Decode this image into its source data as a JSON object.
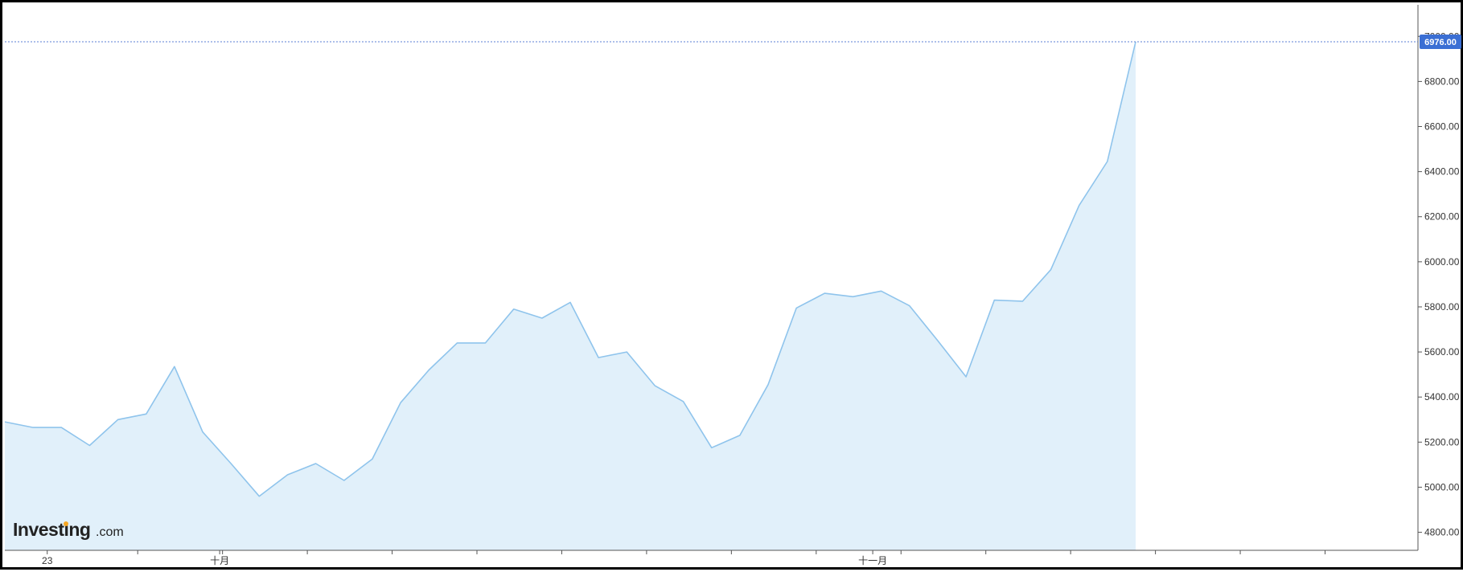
{
  "logo": {
    "main": "Investing",
    "suffix": ".com",
    "accent_color": "#f5a623"
  },
  "colors": {
    "line": "#8fc4ec",
    "area": "#e1f0fa",
    "badge": "#3b6fd4",
    "price_line": "#5b7fd6",
    "axis": "#555555",
    "frame": "#000000"
  },
  "chart_data": {
    "type": "area",
    "title": "",
    "xlabel": "",
    "ylabel": "",
    "ylim": [
      4720,
      7140
    ],
    "y_ticks": [
      "4800.00",
      "5000.00",
      "5200.00",
      "5400.00",
      "5600.00",
      "5800.00",
      "6000.00",
      "6200.00",
      "6400.00",
      "6600.00",
      "6800.00",
      "7000.00"
    ],
    "x_labels": [
      {
        "label": "23",
        "index": 1.5
      },
      {
        "label": "十月",
        "index": 7.6
      },
      {
        "label": "十一月",
        "index": 30.7
      }
    ],
    "x_ticks_index": [
      4.7,
      7.7,
      10.7,
      13.7,
      16.7,
      19.7,
      22.7,
      25.7,
      28.7,
      31.7,
      34.7,
      37.7,
      40.7,
      43.7,
      46.7
    ],
    "x_range": [
      0,
      50.1
    ],
    "last_value_label": "6976.00",
    "last_value": 6976,
    "grid": false,
    "series": [
      {
        "values": [
          5290,
          5265,
          5265,
          5185,
          5300,
          5325,
          5535,
          5245,
          5105,
          4960,
          5055,
          5105,
          5030,
          5125,
          5375,
          5520,
          5640,
          5640,
          5790,
          5750,
          5820,
          5575,
          5600,
          5450,
          5380,
          5175,
          5230,
          5455,
          5795,
          5860,
          5845,
          5870,
          5805,
          5650,
          5490,
          5830,
          5825,
          5965,
          6250,
          6445,
          6976
        ]
      }
    ]
  }
}
